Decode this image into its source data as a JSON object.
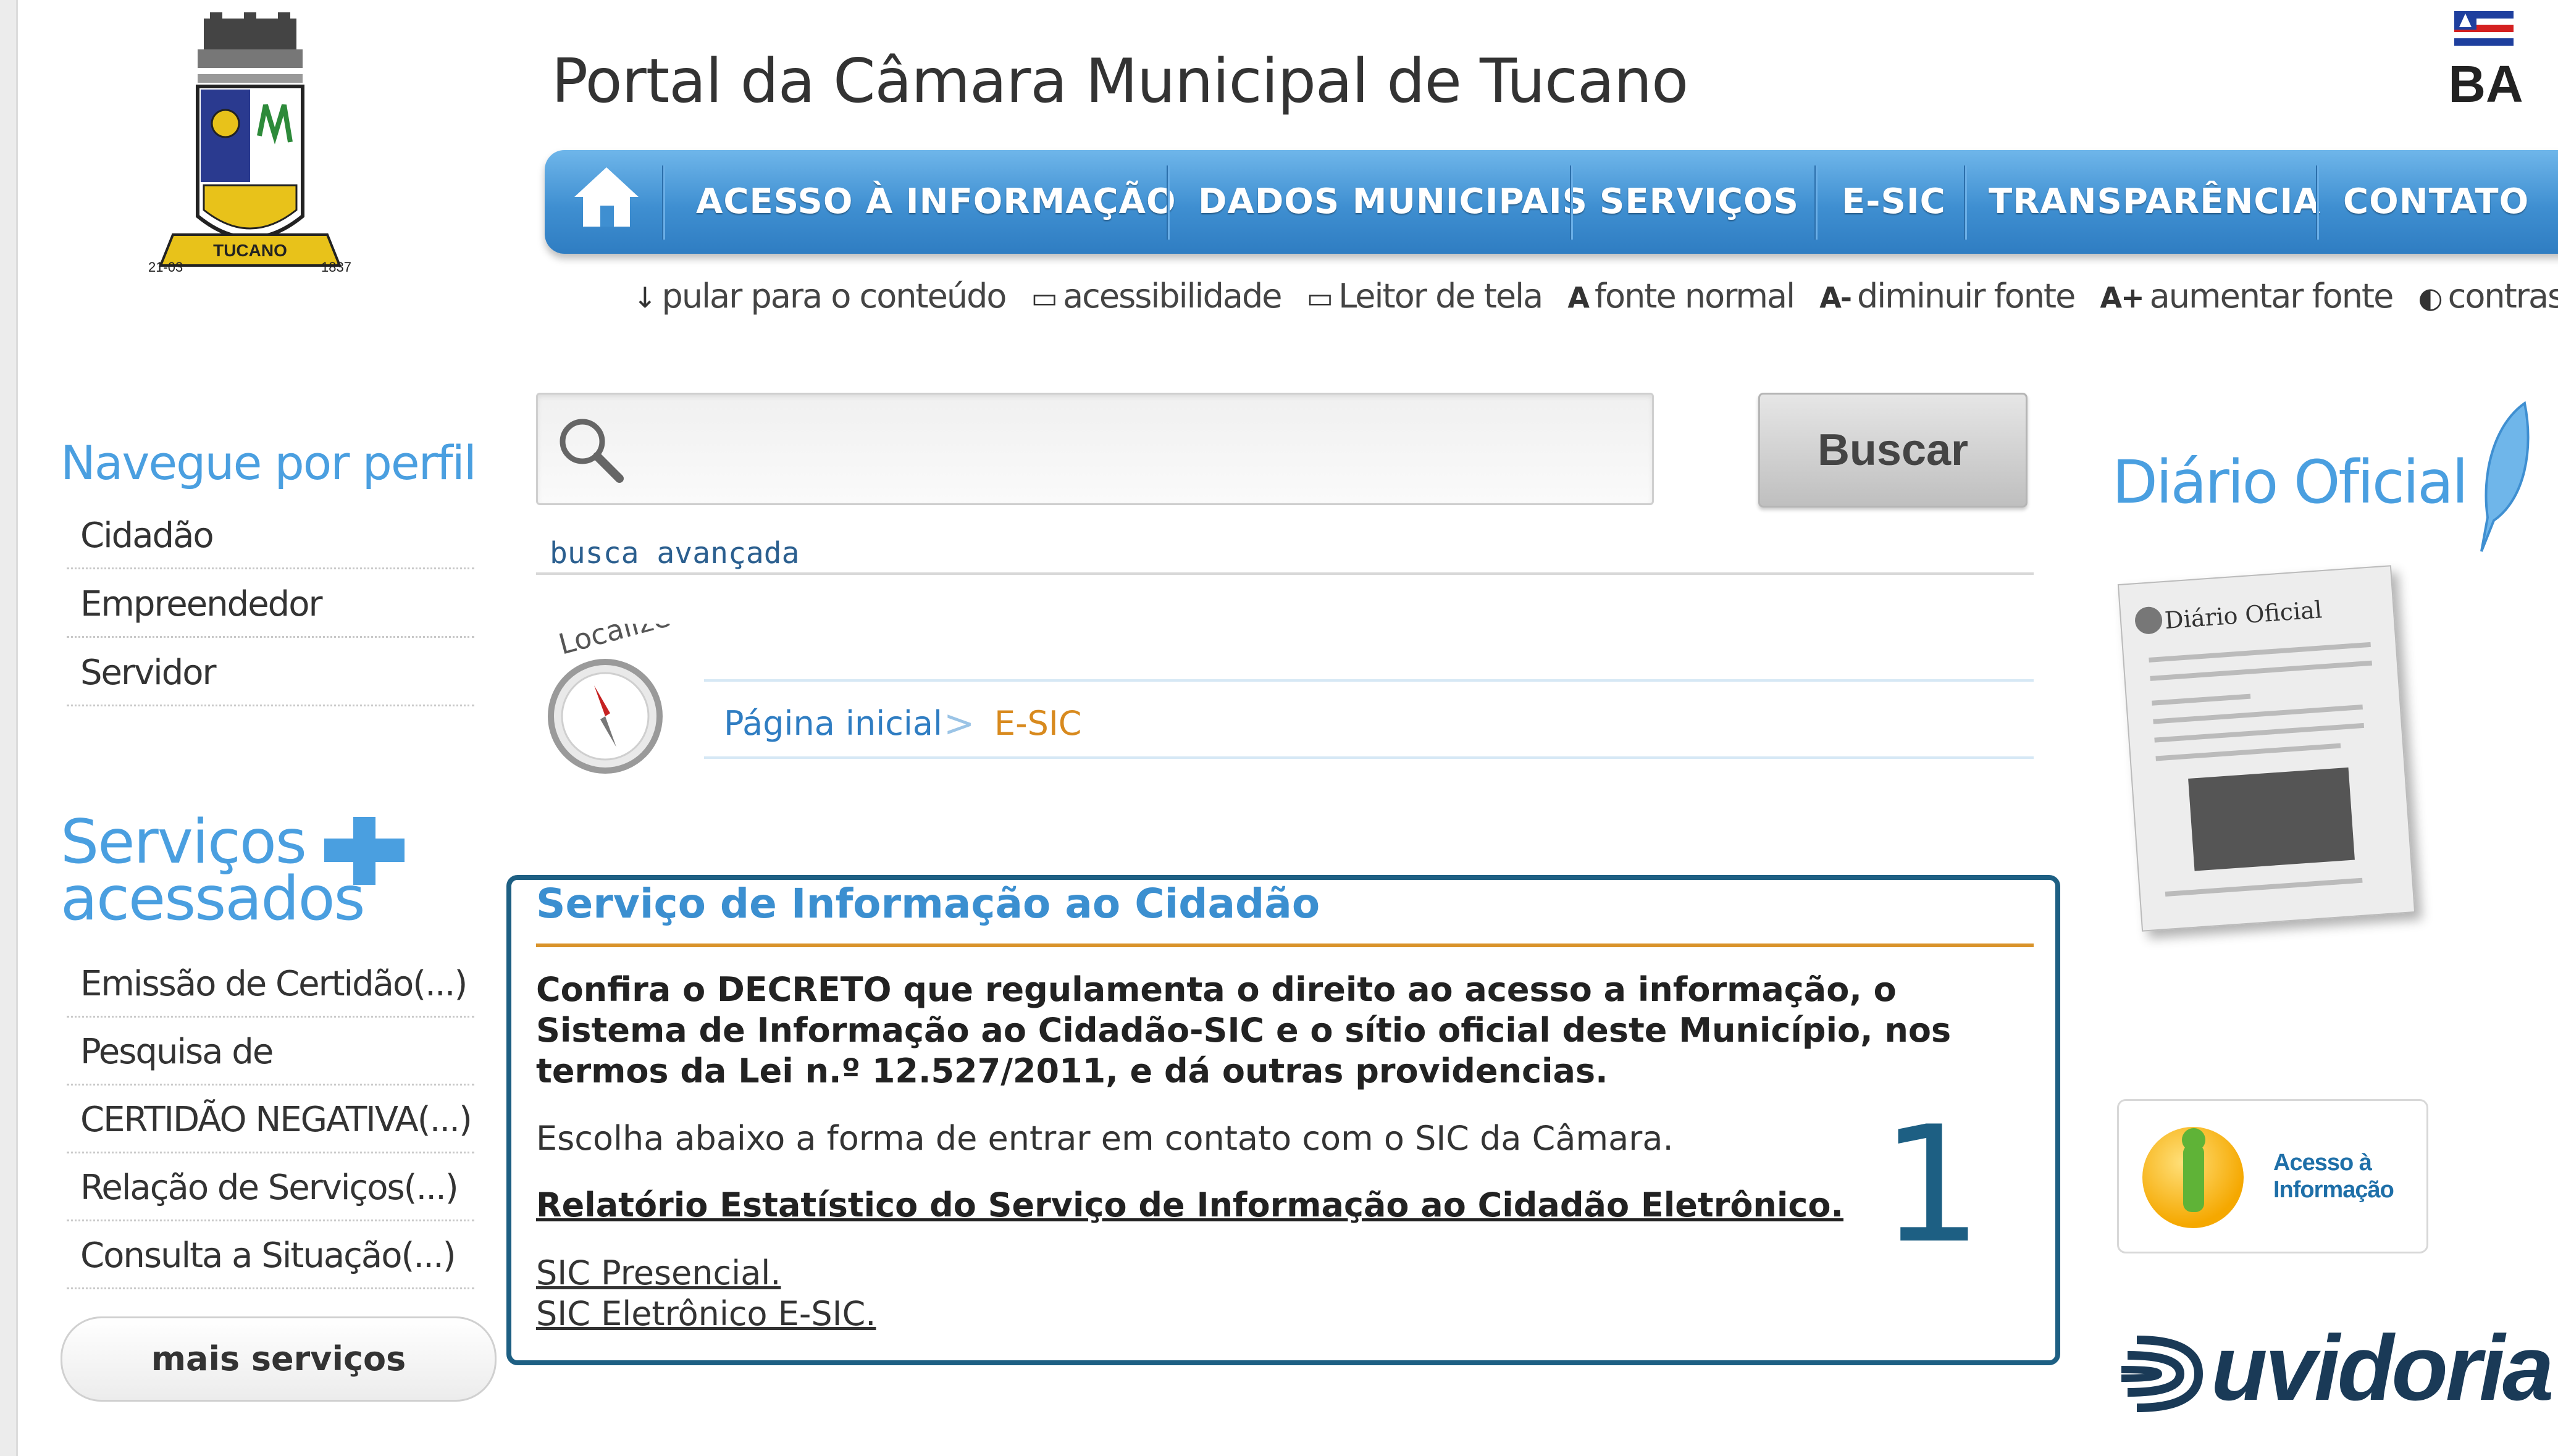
{
  "header": {
    "site_title": "Portal da Câmara Municipal de Tucano",
    "logo_alt": "Brasão de Tucano",
    "logo_ribbon": "TUCANO",
    "logo_years": [
      "21-03",
      "1837"
    ],
    "state_badge": "BA"
  },
  "nav": {
    "items": [
      "ACESSO À INFORMAÇÃO",
      "DADOS MUNICIPAIS",
      "SERVIÇOS",
      "E-SIC",
      "TRANSPARÊNCIA",
      "CONTATO"
    ]
  },
  "accessibility": {
    "skip_content": "pular para o conteúdo",
    "accessibility": "acessibilidade",
    "screen_reader": "Leitor de tela",
    "normal_font_icon": "A",
    "normal_font": "fonte normal",
    "decrease_font_icon": "A-",
    "decrease_font": "diminuir fonte",
    "increase_font_icon": "A+",
    "increase_font": "aumentar fonte",
    "contrast": "contraste"
  },
  "sidebar": {
    "profile_heading": "Navegue por perfil",
    "profiles": [
      "Cidadão",
      "Empreendedor",
      "Servidor"
    ],
    "services_heading_1": "Serviços",
    "services_heading_2": "acessados",
    "services": [
      "Emissão de Certidão(...)",
      "Pesquisa de",
      "CERTIDÃO NEGATIVA(...)",
      "Relação de Serviços(...)",
      "Consulta a Situação(...)"
    ],
    "more_services": "mais serviços"
  },
  "search": {
    "placeholder": "",
    "button_label": "Buscar",
    "advanced_link": "busca avançada"
  },
  "breadcrumb": {
    "badge_text": "Localize-se",
    "home": "Página inicial",
    "separator": ">",
    "current": "E-SIC"
  },
  "content": {
    "title": "Serviço de Informação ao Cidadão",
    "decree": "Confira o DECRETO que regulamenta o direito ao acesso a informação, o Sistema de Informação ao Cidadão-SIC e o sítio oficial deste Município, nos termos da Lei n.º 12.527/2011, e dá outras providencias.",
    "choose": "Escolha abaixo a forma de entrar em contato com o SIC da Câmara.",
    "report_link": "Relatório Estatístico do Serviço de Informação ao Cidadão Eletrônico.",
    "sic_presencial": "SIC Presencial.",
    "sic_eletronico": "SIC Eletrônico E-SIC.",
    "marker": "1",
    "highlight_color": "#1d5f83"
  },
  "right": {
    "diario_heading": "Diário Oficial",
    "diario_thumb_title": "Diário Oficial",
    "acesso_label": "Acesso à Informação",
    "ouvidoria": "uvidoria"
  },
  "colors": {
    "nav_blue": "#3f8fd1",
    "heading_blue": "#4a9fe0",
    "accent_orange": "#d9932a"
  }
}
